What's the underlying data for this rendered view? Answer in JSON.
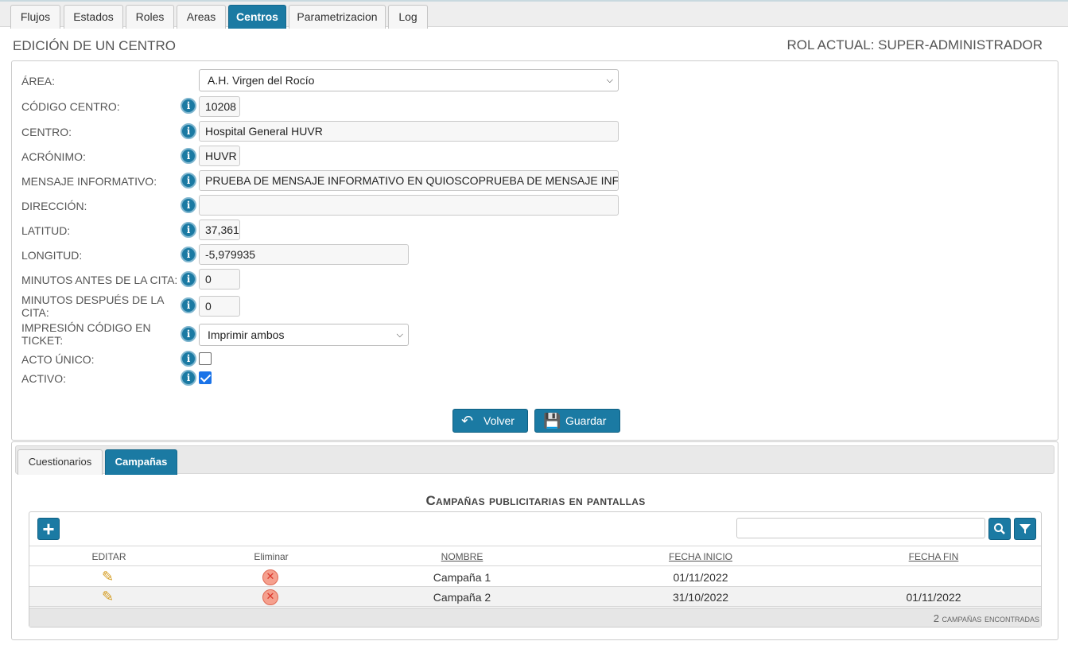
{
  "tabs": [
    {
      "label": "Flujos"
    },
    {
      "label": "Estados"
    },
    {
      "label": "Roles"
    },
    {
      "label": "Areas"
    },
    {
      "label": "Centros",
      "active": true
    },
    {
      "label": "Parametrizacion"
    },
    {
      "label": "Log"
    }
  ],
  "header": {
    "title": "EDICIÓN DE UN CENTRO",
    "role": "ROL ACTUAL: SUPER-ADMINISTRADOR"
  },
  "form": {
    "area": {
      "label": "ÁREA:",
      "value": "A.H. Virgen del Rocío"
    },
    "codigo": {
      "label": "CÓDIGO CENTRO:",
      "value": "10208"
    },
    "centro": {
      "label": "CENTRO:",
      "value": "Hospital General HUVR"
    },
    "acronimo": {
      "label": "ACRÓNIMO:",
      "value": "HUVR"
    },
    "mensaje": {
      "label": "MENSAJE INFORMATIVO:",
      "value": "PRUEBA DE MENSAJE INFORMATIVO EN QUIOSCOPRUEBA DE MENSAJE INFORMATIVO EN QUIOSCO"
    },
    "direccion": {
      "label": "DIRECCIÓN:",
      "value": ""
    },
    "latitud": {
      "label": "LATITUD:",
      "value": "37,361"
    },
    "longitud": {
      "label": "LONGITUD:",
      "value": "-5,979935"
    },
    "minutos_antes": {
      "label": "MINUTOS ANTES DE LA CITA:",
      "value": "0"
    },
    "minutos_despues": {
      "label": "MINUTOS DESPUÉS DE LA CITA:",
      "value": "0"
    },
    "impresion": {
      "label": "IMPRESIÓN CÓDIGO EN TICKET:",
      "value": "Imprimir ambos"
    },
    "acto_unico": {
      "label": "ACTO ÚNICO:",
      "checked": false
    },
    "activo": {
      "label": "ACTIVO:",
      "checked": true
    }
  },
  "buttons": {
    "volver": "Volver",
    "guardar": "Guardar"
  },
  "subtabs": [
    {
      "label": "Cuestionarios"
    },
    {
      "label": "Campañas",
      "active": true
    }
  ],
  "table": {
    "title": "Campañas publicitarias en pantallas",
    "columns": {
      "editar": "EDITAR",
      "eliminar": "Eliminar",
      "nombre": "NOMBRE",
      "fecha_inicio": "FECHA INICIO",
      "fecha_fin": "FECHA FIN"
    },
    "rows": [
      {
        "nombre": "Campaña 1",
        "fecha_inicio": "01/11/2022",
        "fecha_fin": ""
      },
      {
        "nombre": "Campaña 2",
        "fecha_inicio": "31/10/2022",
        "fecha_fin": "01/11/2022"
      }
    ],
    "footer": "2 campañas encontradas"
  },
  "colors": {
    "accent": "#1b7aa3"
  }
}
